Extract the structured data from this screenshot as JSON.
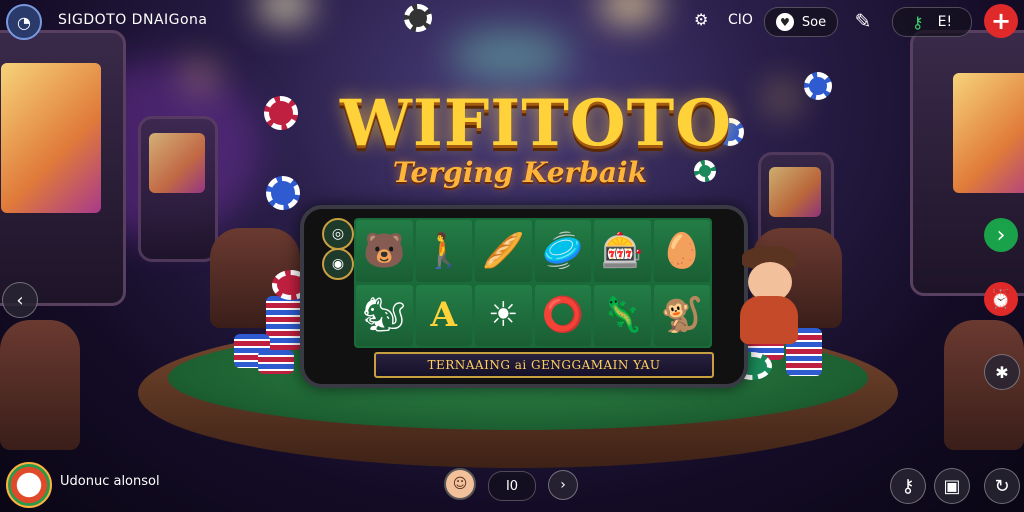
{
  "header": {
    "site_name": "SIGDOTO DNAIGona",
    "counter_label": "CIO",
    "account_pill_label": "Soe",
    "menu_label": "E!"
  },
  "hero": {
    "title": "WIFITOTO",
    "subtitle": "Terging Kerbaik",
    "banner_text": "TERNAAING ai GENGGAMAIN YAU"
  },
  "reels": {
    "symbols": [
      "🐻",
      "🚶",
      "🥖",
      "🥏",
      "🎰",
      "🥚",
      "🐿",
      "A",
      "☀",
      "⭕",
      "🦎",
      "🐒"
    ]
  },
  "footer": {
    "username": "Udonuc alonsol",
    "page_label": "I0"
  },
  "colors": {
    "accent_gold": "#ffd23a",
    "add_button_red": "#e02a2a",
    "next_button_green": "#1aa24a"
  },
  "icons": {
    "logo": "logo-icon",
    "counter": "gift-icon",
    "account": "heart-icon",
    "edit": "pencil-icon",
    "key": "key-icon",
    "menu": "grid-icon",
    "add": "plus-icon",
    "next": "chevron-right-icon",
    "prev": "chevron-left-icon",
    "alarm": "alarm-icon",
    "social": "share-icon"
  }
}
